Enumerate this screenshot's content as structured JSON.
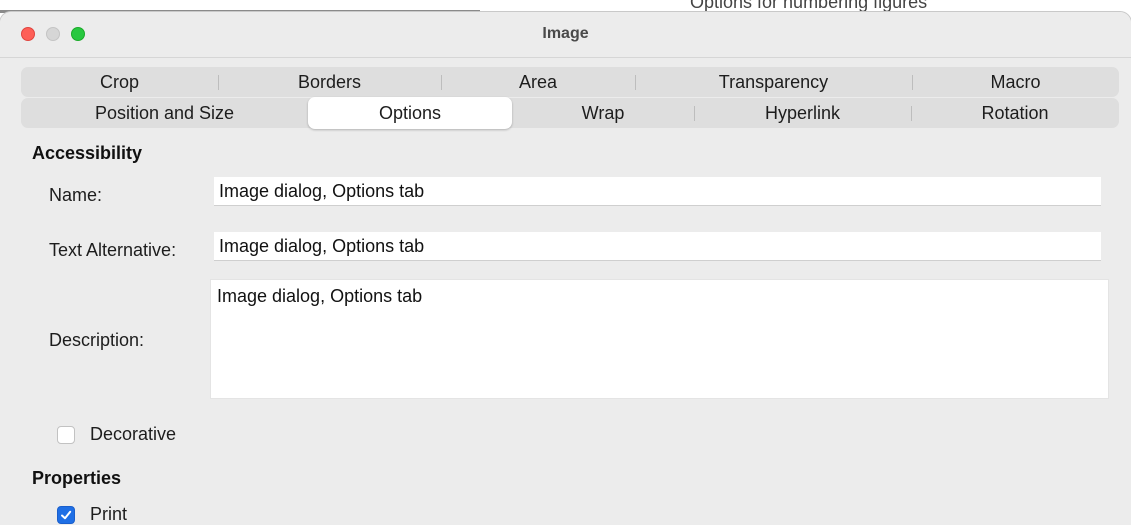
{
  "background": {
    "ghost_text": "Options for numbering figures"
  },
  "window": {
    "title": "Image",
    "traffic_lights": {
      "close_color": "#fe5f57",
      "minimize_color": "#d6d6d6",
      "maximize_color": "#28c840"
    }
  },
  "tabs": {
    "row1": [
      "Crop",
      "Borders",
      "Area",
      "Transparency",
      "Macro"
    ],
    "row2": [
      "Position and Size",
      "Options",
      "Wrap",
      "Hyperlink",
      "Rotation"
    ],
    "selected": "Options"
  },
  "accessibility": {
    "heading": "Accessibility",
    "name_label": "Name:",
    "name_value": "Image dialog, Options tab",
    "text_alt_label": "Text Alternative:",
    "text_alt_value": "Image dialog, Options tab",
    "description_label": "Description:",
    "description_value": "Image dialog, Options tab",
    "decorative_label": "Decorative",
    "decorative_checked": false
  },
  "properties": {
    "heading": "Properties",
    "print_label": "Print",
    "print_checked": true
  },
  "colors": {
    "accent": "#1f6fe5"
  }
}
